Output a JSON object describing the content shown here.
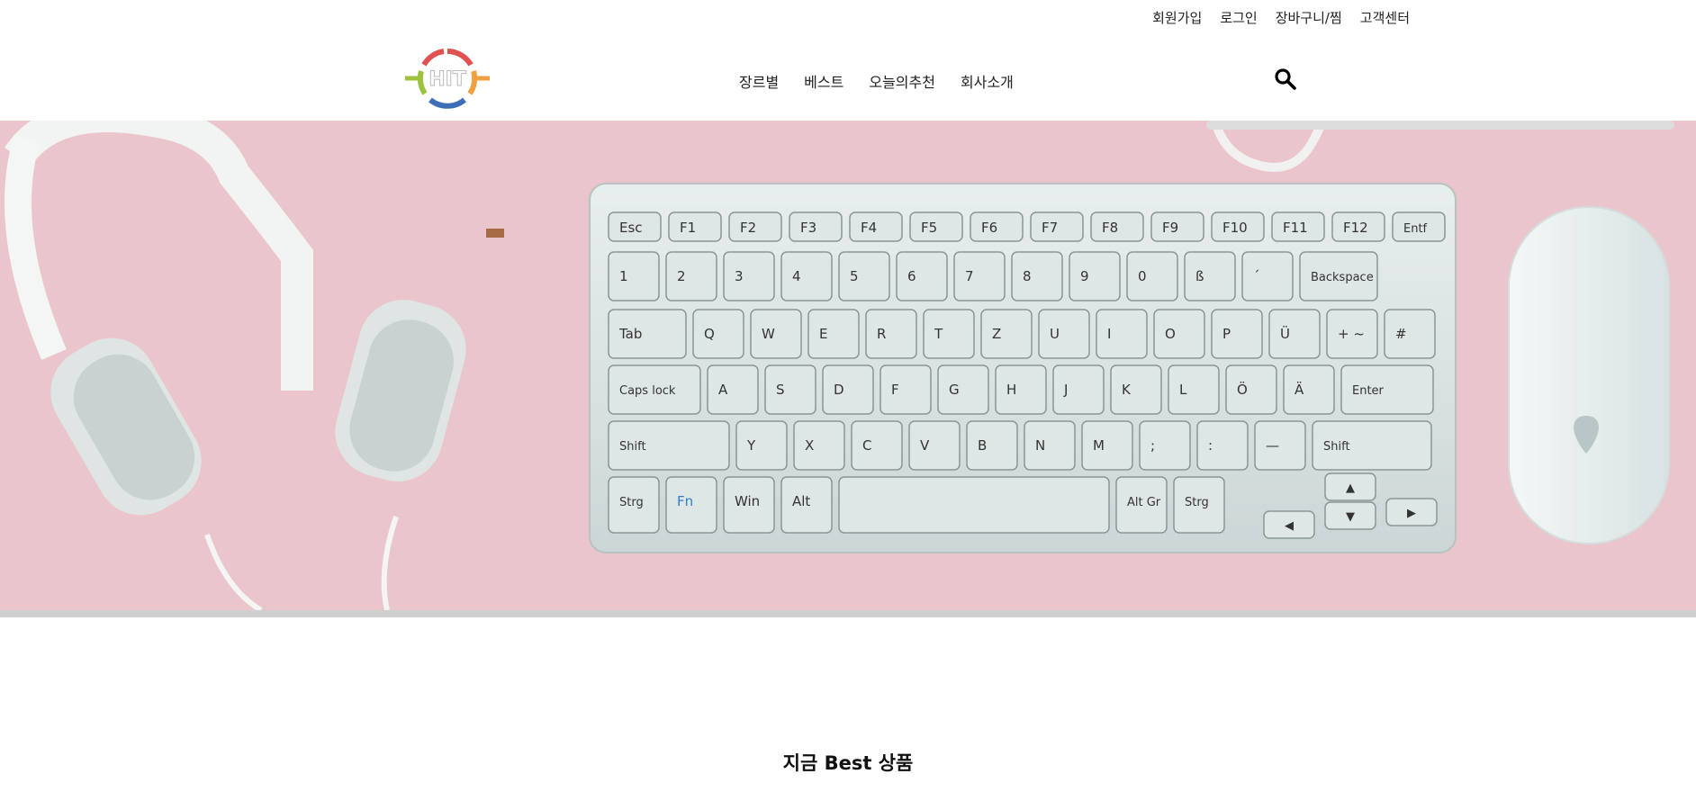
{
  "top_links": {
    "signup": "회원가입",
    "login": "로그인",
    "cart": "장바구니/찜",
    "support": "고객센터"
  },
  "logo": {
    "text": "HIT"
  },
  "nav": {
    "genre": "장르별",
    "best": "베스트",
    "today_pick": "오늘의추천",
    "about": "회사소개"
  },
  "icons": {
    "search": "search-icon"
  },
  "colors": {
    "hero_bg": "#eac6cc",
    "logo_red": "#e05252",
    "logo_orange": "#f0a040",
    "logo_green": "#9bc33e",
    "logo_blue": "#3d6db5"
  },
  "keyboard": {
    "row0": [
      "Esc",
      "F1",
      "F2",
      "F3",
      "F4",
      "F5",
      "F6",
      "F7",
      "F8",
      "F9",
      "F10",
      "F11",
      "F12",
      "Entf"
    ],
    "row1": [
      "1",
      "2",
      "3",
      "4",
      "5",
      "6",
      "7",
      "8",
      "9",
      "0",
      "ß",
      "´",
      "Backspace"
    ],
    "row2": [
      "Tab",
      "Q",
      "W",
      "E",
      "R",
      "T",
      "Z",
      "U",
      "I",
      "O",
      "P",
      "Ü",
      "+ ~",
      "#"
    ],
    "row3": [
      "Caps lock",
      "A",
      "S",
      "D",
      "F",
      "G",
      "H",
      "J",
      "K",
      "L",
      "Ö",
      "Ä",
      "Enter"
    ],
    "row4": [
      "Shift",
      "Y",
      "X",
      "C",
      "V",
      "B",
      "N",
      "M",
      ";",
      ":",
      "—",
      "Shift"
    ],
    "row5": [
      "Strg",
      "Fn",
      "Win",
      "Alt",
      "",
      "Alt Gr",
      "Strg"
    ]
  },
  "section": {
    "title": "지금 Best 상품"
  }
}
